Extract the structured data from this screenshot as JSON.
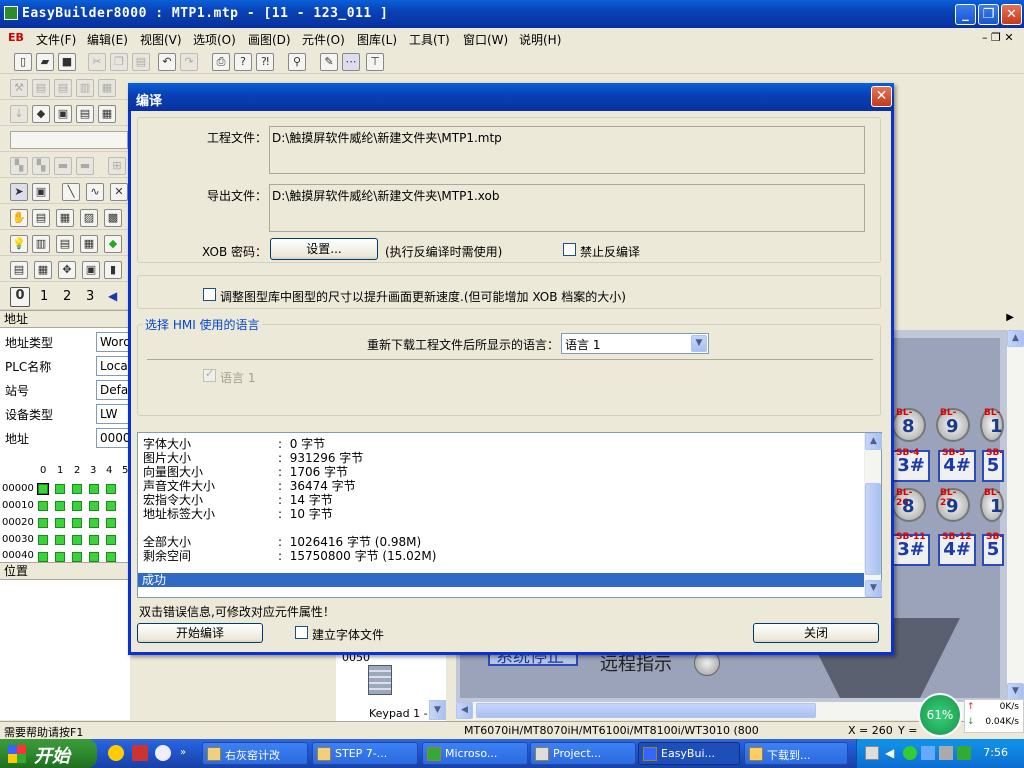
{
  "app": {
    "title": "EasyBuilder8000 : MTP1.mtp - [11 - 123_011 ]",
    "menu": [
      "文件(F)",
      "编辑(E)",
      "视图(V)",
      "选项(O)",
      "画图(D)",
      "元件(O)",
      "图库(L)",
      "工具(T)",
      "窗口(W)",
      "说明(H)"
    ],
    "logo_text": "EB"
  },
  "toolbar": {
    "page_numbers": [
      "0",
      "1",
      "2",
      "3"
    ]
  },
  "left_panel": {
    "address_header": "地址",
    "position_header": "位置",
    "fields": [
      {
        "label": "地址类型",
        "value": "Word"
      },
      {
        "label": "PLC名称",
        "value": "Local"
      },
      {
        "label": "站号",
        "value": "Defau"
      },
      {
        "label": "设备类型",
        "value": "LW"
      },
      {
        "label": "地址",
        "value": "00000"
      }
    ],
    "grid_cols": [
      "0",
      "1",
      "2",
      "3",
      "4",
      "5"
    ],
    "grid_rows": [
      "00000",
      "00010",
      "00020",
      "00030",
      "00040"
    ]
  },
  "library": {
    "item_number": "0050",
    "item_label": "Keypad 1 - I"
  },
  "canvas": {
    "text_remote": "远程指示",
    "text_system": "系统停止",
    "bl_labels": [
      "BL-",
      "BL-",
      "BL-",
      "BL-26",
      "BL-27",
      "BL-"
    ],
    "sb_labels": [
      {
        "tag": "SB-4",
        "num": "3#"
      },
      {
        "tag": "SB-5",
        "num": "4#"
      },
      {
        "tag": "SB-",
        "num": "5"
      },
      {
        "tag": "SB-11",
        "num": "3#"
      },
      {
        "tag": "SB-12",
        "num": "4#"
      },
      {
        "tag": "SB-",
        "num": "5"
      }
    ]
  },
  "dialog": {
    "title": "编译",
    "project_file_label": "工程文件：",
    "project_file_value": "D:\\触摸屏软件威纶\\新建文件夹\\MTP1.mtp",
    "export_file_label": "导出文件：",
    "export_file_value": "D:\\触摸屏软件威纶\\新建文件夹\\MTP1.xob",
    "xob_password_label": "XOB 密码：",
    "set_button": "设置...",
    "set_hint": "(执行反编译时需使用)",
    "no_decompile_label": "禁止反编译",
    "adjust_label": "调整图型库中图型的尺寸以提升画面更新速度.(但可能增加 XOB 档案的大小)",
    "lang_group_title": "选择 HMI 使用的语言",
    "reload_lang_label": "重新下载工程文件后所显示的语言：",
    "lang_selected": "语言 1",
    "lang1_checkbox": "语言 1",
    "log": [
      {
        "label": "字体大小",
        "value": "0 字节"
      },
      {
        "label": "图片大小",
        "value": "931296 字节"
      },
      {
        "label": "向量图大小",
        "value": "1706 字节"
      },
      {
        "label": "声音文件大小",
        "value": "36474 字节"
      },
      {
        "label": "宏指令大小",
        "value": "14 字节"
      },
      {
        "label": "地址标签大小",
        "value": "10 字节"
      },
      {
        "label": "全部大小",
        "value": "1026416 字节 (0.98M)"
      },
      {
        "label": "剩余空间",
        "value": "15750800 字节 (15.02M)"
      }
    ],
    "log_separator": ":",
    "log_success": "成功",
    "hint": "双击错误信息,可修改对应元件属性！",
    "start_button": "开始编译",
    "build_font_label": "建立字体文件",
    "close_button": "关闭"
  },
  "statusbar": {
    "help": "需要帮助请按F1",
    "models": "MT6070iH/MT8070iH/MT6100i/MT8100i/WT3010 (800",
    "x": "X = 260",
    "y": "Y ="
  },
  "netmon": {
    "percent": "61%",
    "up": "0K/s",
    "down": "0.04K/s"
  },
  "taskbar": {
    "start": "开始",
    "tasks": [
      "右灰窑计改",
      "STEP 7-...",
      "Microso...",
      "Project...",
      "EasyBui...",
      "下载到..."
    ],
    "clock": "7:56"
  }
}
